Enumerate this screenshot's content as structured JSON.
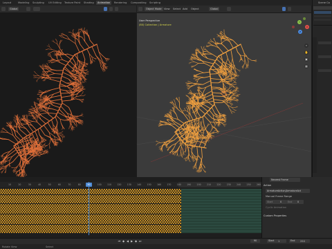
{
  "workspace_tabs": [
    "Layout",
    "Modeling",
    "Sculpting",
    "UV Editing",
    "Texture Paint",
    "Shading",
    "Animation",
    "Rendering",
    "Compositing",
    "Scripting"
  ],
  "active_tab_index": 6,
  "left_viewport": {
    "orientation": "Global",
    "options_label": "Options"
  },
  "right_viewport": {
    "mode": "Object Mode",
    "menus": [
      "View",
      "Select",
      "Add",
      "Object"
    ],
    "orientation": "Global",
    "options_label": "Options",
    "overlay_title": "User Perspective",
    "overlay_subtitle": "(80) Collection | Armature",
    "subtitle_color": "#d8d84a"
  },
  "outliner": {
    "title": "Scene Co"
  },
  "timeline": {
    "menus": [
      "View",
      "Marker",
      "Channel",
      "Key"
    ],
    "ticks": [
      "10",
      "20",
      "30",
      "40",
      "50",
      "60",
      "70",
      "80",
      "90",
      "100",
      "110",
      "120",
      "130",
      "140",
      "150",
      "160",
      "170",
      "180",
      "190",
      "200",
      "210",
      "220",
      "230",
      "240",
      "250",
      "260"
    ],
    "current_frame": "90",
    "key_color": "#e8a424"
  },
  "properties": {
    "dropdown": "Nearest Frame",
    "section_action": "Action",
    "action_name": "ArmatureAction|ArmatureAct",
    "manual_frame_range": "Manual Frame Range",
    "start_label": "Start",
    "start_value": "0",
    "end_label": "End",
    "end_value": "0",
    "cyclic_label": "Cyclic Animation",
    "custom_props": "Custom Properties"
  },
  "playback": {
    "frame": "90",
    "start_label": "Start",
    "start_value": "1",
    "end_label": "End",
    "end_value": "250"
  },
  "status": {
    "left": "Rotate View",
    "mid": "Select"
  },
  "colors": {
    "accent": "#4772b3",
    "tree_left": "#e0703a",
    "tree_right": "#f0a040"
  }
}
